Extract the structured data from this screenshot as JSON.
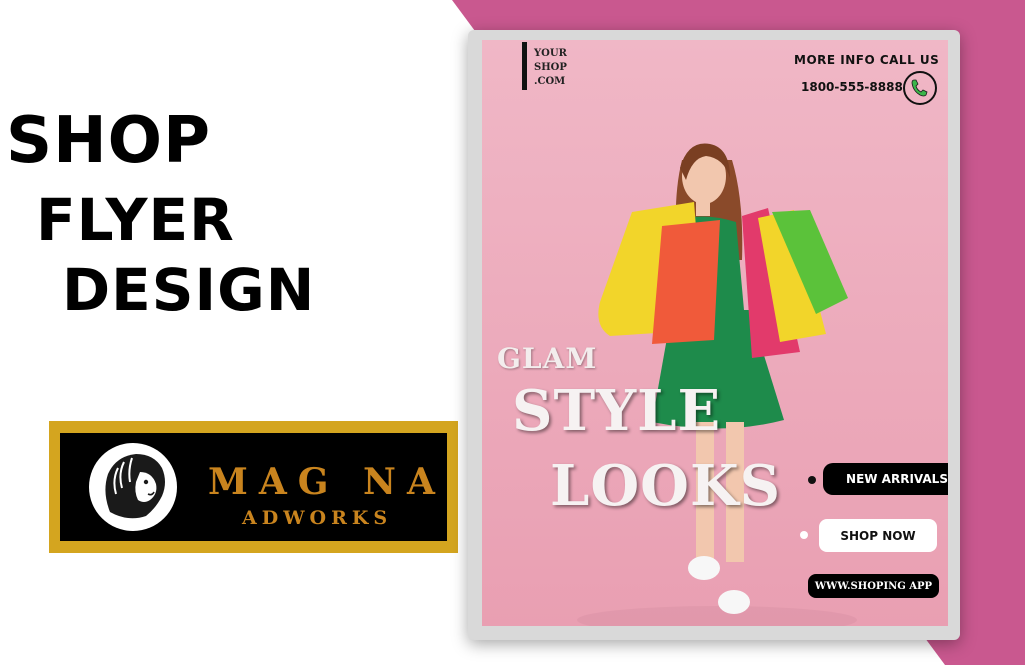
{
  "headline": {
    "line1": "SHOP",
    "line2": "FLYER",
    "line3": "DESIGN"
  },
  "brand": {
    "name": "MAG NA",
    "tagline": "ADWORKS",
    "logo_icon": "lion-head-icon",
    "gold_color": "#d4a51f",
    "text_color": "#c9841e"
  },
  "flyer": {
    "shop_url_lines": [
      "YOUR",
      "SHOP",
      ".COM"
    ],
    "info_label": "MORE INFO CALL US",
    "phone_number": "1800-555-8888",
    "phone_icon": "phone-icon",
    "headline_small": "GLAM",
    "headline_big_1": "STYLE",
    "headline_big_2": "LOOKS",
    "new_arrivals_label": "NEW ARRIVALS",
    "shop_now_label": "SHOP NOW",
    "website_label": "WWW.SHOPING APP",
    "background_color": "#eeb0c0",
    "accent_pink": "#c9588f"
  }
}
